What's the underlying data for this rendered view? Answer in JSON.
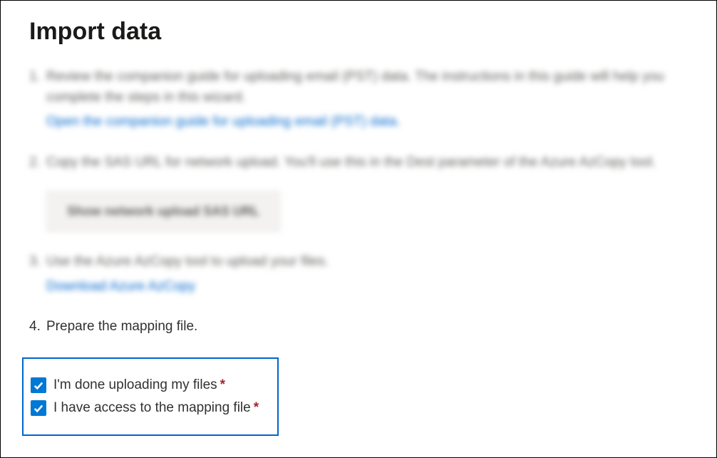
{
  "title": "Import data",
  "steps": {
    "s1": {
      "text": "Review the companion guide for uploading email (PST) data. The instructions in this guide will help you complete the steps in this wizard.",
      "link": "Open the companion guide for uploading email (PST) data."
    },
    "s2": {
      "text": "Copy the SAS URL for network upload. You'll use this in the Dest parameter of the Azure AzCopy tool.",
      "button": "Show network upload SAS URL"
    },
    "s3": {
      "text": "Use the Azure AzCopy tool to upload your files.",
      "link": "Download Azure AzCopy"
    },
    "s4": {
      "text": "Prepare the mapping file."
    }
  },
  "checkboxes": {
    "done_uploading": {
      "label": "I'm done uploading my files",
      "required": "*",
      "checked": true
    },
    "have_access": {
      "label": "I have access to the mapping file",
      "required": "*",
      "checked": true
    }
  }
}
